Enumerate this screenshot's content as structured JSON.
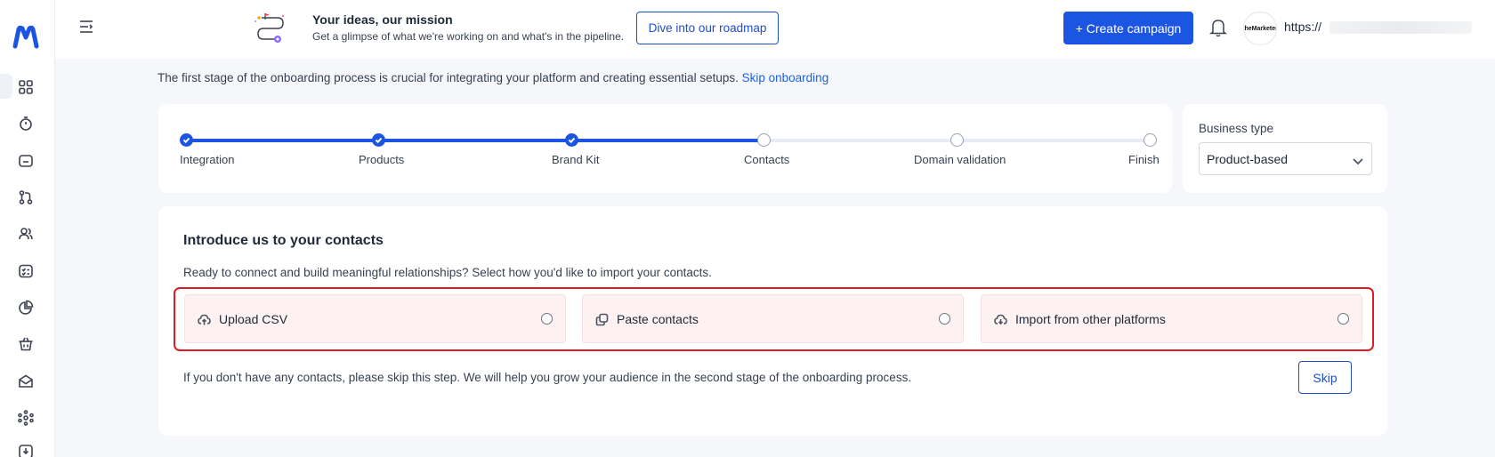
{
  "header": {
    "promo_title": "Your ideas, our mission",
    "promo_subtitle": "Get a glimpse of what we're working on and what's in the pipeline.",
    "roadmap_button": "Dive into our roadmap",
    "create_button": "+ Create campaign",
    "avatar_text": "theMarketer",
    "account_url": "https://"
  },
  "onboarding": {
    "intro_text": "The first stage of the onboarding process is crucial for integrating your platform and creating essential setups.",
    "skip_link": "Skip onboarding",
    "steps": [
      {
        "label": "Integration",
        "status": "done"
      },
      {
        "label": "Products",
        "status": "done"
      },
      {
        "label": "Brand Kit",
        "status": "done"
      },
      {
        "label": "Contacts",
        "status": "todo"
      },
      {
        "label": "Domain validation",
        "status": "todo"
      },
      {
        "label": "Finish",
        "status": "todo"
      }
    ],
    "business_type": {
      "label": "Business type",
      "value": "Product-based"
    }
  },
  "contacts": {
    "title": "Introduce us to your contacts",
    "description": "Ready to connect and build meaningful relationships? Select how you'd like to import your contacts.",
    "options": [
      {
        "label": "Upload CSV",
        "icon": "upload-cloud-icon"
      },
      {
        "label": "Paste contacts",
        "icon": "copy-icon"
      },
      {
        "label": "Import from other platforms",
        "icon": "cloud-download-icon"
      }
    ],
    "skip_note": "If you don't have any contacts, please skip this step. We will help you grow your audience in the second stage of the onboarding process.",
    "skip_button": "Skip"
  },
  "colors": {
    "primary": "#1d55e3",
    "highlight": "#e01b24",
    "option_bg": "#fdf1f1"
  },
  "sidebar": {
    "items": [
      {
        "icon": "dashboard-icon"
      },
      {
        "icon": "timer-icon"
      },
      {
        "icon": "folder-icon"
      },
      {
        "icon": "flow-icon"
      },
      {
        "icon": "users-icon"
      },
      {
        "icon": "checklist-icon"
      },
      {
        "icon": "pie-chart-icon"
      },
      {
        "icon": "basket-icon"
      },
      {
        "icon": "mail-icon"
      },
      {
        "icon": "network-icon"
      },
      {
        "icon": "download-icon"
      }
    ]
  }
}
